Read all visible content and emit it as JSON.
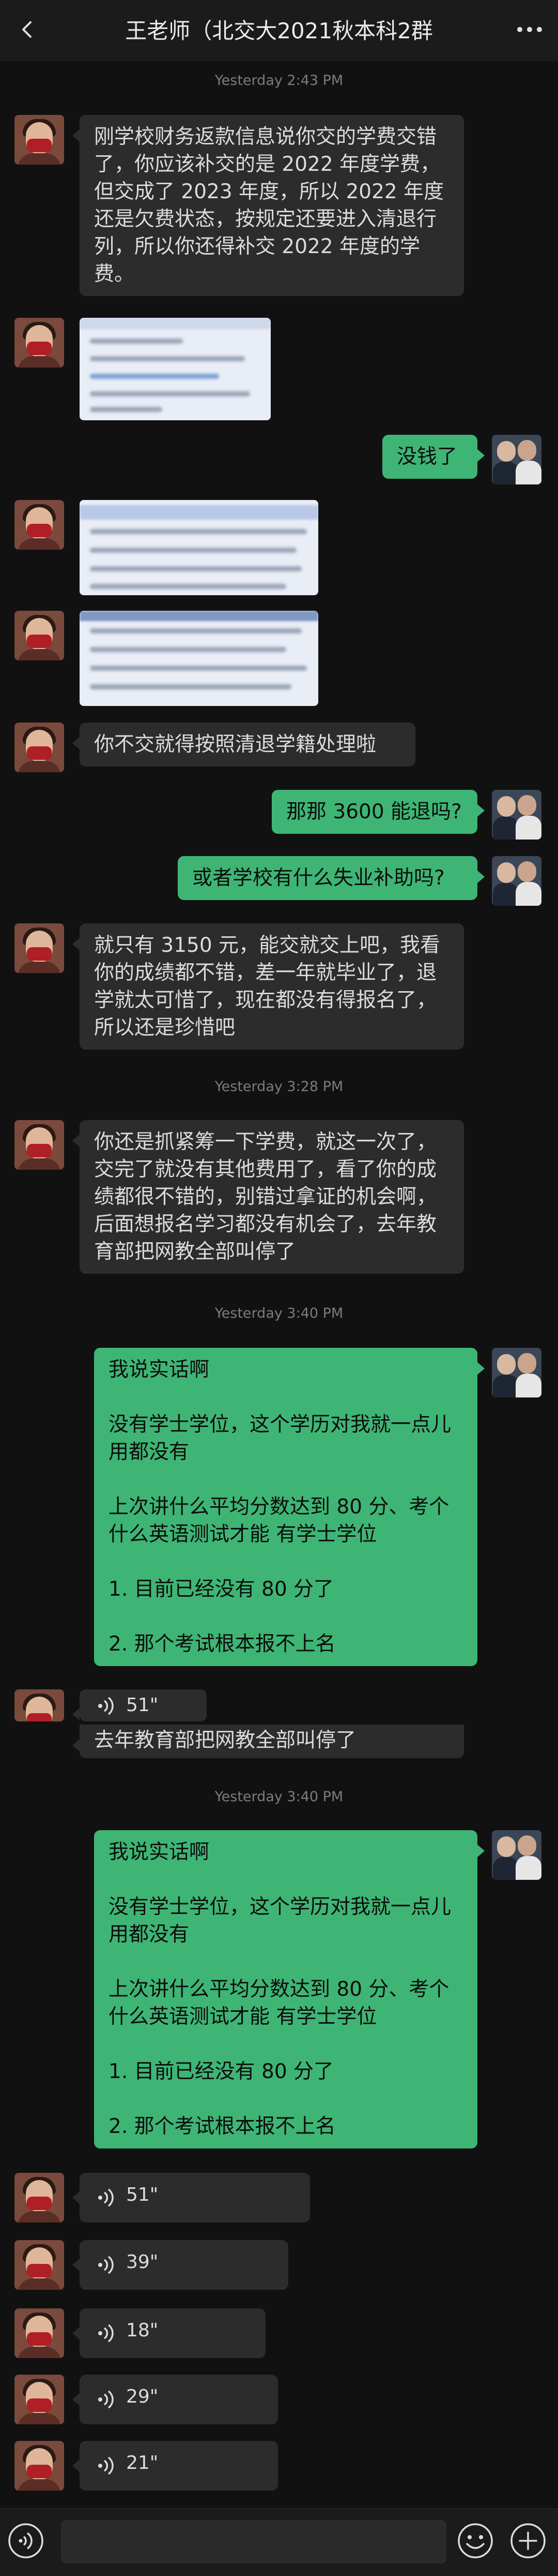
{
  "header": {
    "title": "王老师（北交大2021秋本科2群"
  },
  "timestamps": [
    "Yesterday 2:43 PM",
    "Yesterday 3:28 PM",
    "Yesterday 3:40 PM",
    "Yesterday 3:40 PM"
  ],
  "messages": [
    {
      "text": "刚学校财务返款信息说你交的学费交错了，你应该补交的是 2022 年度学费，但交成了 2023 年度，所以 2022 年度还是欠费状态，按规定还要进入清退行列，所以你还得补交 2022 年度的学费。"
    },
    {
      "text": "没钱了"
    },
    {
      "text": "你不交就得按照清退学籍处理啦"
    },
    {
      "text": "那那 3600 能退吗?"
    },
    {
      "text": "或者学校有什么失业补助吗?"
    },
    {
      "text": "就只有 3150 元，能交就交上吧，我看你的成绩都不错，差一年就毕业了，退学就太可惜了，现在都没有得报名了，所以还是珍惜吧"
    },
    {
      "text": "你还是抓紧筹一下学费，就这一次了，交完了就没有其他费用了，看了你的成绩都很不错的，别错过拿证的机会啊，后面想报名学习都没有机会了，去年教育部把网教全部叫停了"
    },
    {
      "text": "我说实话啊\n\n没有学士学位，这个学历对我就一点儿用都没有\n\n上次讲什么平均分数达到 80 分、考个什么英语测试才能 有学士学位\n\n1. 目前已经没有 80 分了\n\n2. 那个考试根本报不上名"
    },
    {
      "text": "去年教育部把网教全部叫停了"
    },
    {
      "text": "我说实话啊\n\n没有学士学位，这个学历对我就一点儿用都没有\n\n上次讲什么平均分数达到 80 分、考个什么英语测试才能 有学士学位\n\n1. 目前已经没有 80 分了\n\n2. 那个考试根本报不上名"
    }
  ],
  "voices": [
    "51\"",
    "51\"",
    "39\"",
    "18\"",
    "29\"",
    "21\""
  ],
  "colors": {
    "background": "#111111",
    "incoming": "#2c2c2c",
    "outgoing": "#3eb575"
  }
}
